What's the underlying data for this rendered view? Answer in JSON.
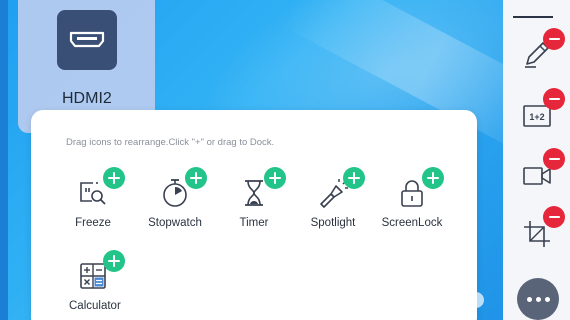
{
  "source": {
    "label": "HDMI2",
    "icon": "hdmi-icon"
  },
  "panel": {
    "hint": "Drag icons to rearrange.Click \"+\" or drag to Dock.",
    "tools": [
      {
        "label": "Freeze",
        "icon": "freeze-icon"
      },
      {
        "label": "Stopwatch",
        "icon": "stopwatch-icon"
      },
      {
        "label": "Timer",
        "icon": "hourglass-icon"
      },
      {
        "label": "Spotlight",
        "icon": "flashlight-icon"
      },
      {
        "label": "ScreenLock",
        "icon": "lock-icon"
      },
      {
        "label": "Calculator",
        "icon": "calculator-icon"
      }
    ]
  },
  "dock": {
    "items": [
      {
        "icon": "pen-icon"
      },
      {
        "icon": "split-screen-icon",
        "text": "1+2"
      },
      {
        "icon": "camera-icon"
      },
      {
        "icon": "crop-icon"
      }
    ],
    "more_icon": "more-icon"
  },
  "colors": {
    "accent_add": "#22c489",
    "remove": "#e6263a",
    "hdmi_tile": "#3a4f75"
  }
}
